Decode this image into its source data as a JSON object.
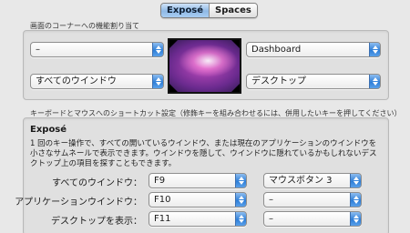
{
  "tabs": [
    {
      "label": "Exposé",
      "active": true
    },
    {
      "label": "Spaces",
      "active": false
    }
  ],
  "corners": {
    "section_label": "画面のコーナーへの機能割り当て",
    "top_left": "–",
    "top_right": "Dashboard",
    "bottom_left": "すべてのウインドウ",
    "bottom_right": "デスクトップ"
  },
  "shortcuts": {
    "section_label": "キーボードとマウスへのショートカット設定（修飾キーを組み合わせるには、併用したいキーを押してください）",
    "heading": "Exposé",
    "description": "1 回のキー操作で、すべての開いているウインドウ、または現在のアプリケーションのウインドウを小さなサムネールで表示できます。ウインドウを隠して、ウインドウに隠れているかもしれないデスクトップ上の項目を探すこともできます。",
    "rows": [
      {
        "label": "すべてのウインドウ：",
        "key": "F9",
        "mouse": "マウスボタン 3"
      },
      {
        "label": "アプリケーションウインドウ：",
        "key": "F10",
        "mouse": "–"
      },
      {
        "label": "デスクトップを表示：",
        "key": "F11",
        "mouse": "–"
      }
    ]
  },
  "colors": {
    "accent": "#2f7fd8",
    "tab_active": "#8fb9e6",
    "background": "#e8e8e8"
  }
}
